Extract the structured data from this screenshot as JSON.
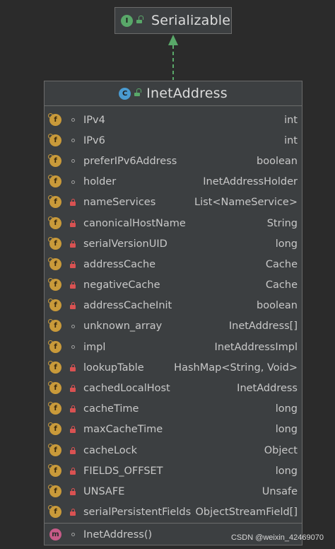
{
  "interface": {
    "badge": "I",
    "name": "Serializable"
  },
  "class": {
    "badge": "C",
    "name": "InetAddress",
    "fields": [
      {
        "name": "IPv4",
        "type": "int",
        "visibility": "package"
      },
      {
        "name": "IPv6",
        "type": "int",
        "visibility": "package"
      },
      {
        "name": "preferIPv6Address",
        "type": "boolean",
        "visibility": "package"
      },
      {
        "name": "holder",
        "type": "InetAddressHolder",
        "visibility": "package"
      },
      {
        "name": "nameServices",
        "type": "List<NameService>",
        "visibility": "private"
      },
      {
        "name": "canonicalHostName",
        "type": "String",
        "visibility": "private"
      },
      {
        "name": "serialVersionUID",
        "type": "long",
        "visibility": "private"
      },
      {
        "name": "addressCache",
        "type": "Cache",
        "visibility": "private"
      },
      {
        "name": "negativeCache",
        "type": "Cache",
        "visibility": "private"
      },
      {
        "name": "addressCacheInit",
        "type": "boolean",
        "visibility": "private"
      },
      {
        "name": "unknown_array",
        "type": "InetAddress[]",
        "visibility": "package"
      },
      {
        "name": "impl",
        "type": "InetAddressImpl",
        "visibility": "package"
      },
      {
        "name": "lookupTable",
        "type": "HashMap<String, Void>",
        "visibility": "private"
      },
      {
        "name": "cachedLocalHost",
        "type": "InetAddress",
        "visibility": "private"
      },
      {
        "name": "cacheTime",
        "type": "long",
        "visibility": "private"
      },
      {
        "name": "maxCacheTime",
        "type": "long",
        "visibility": "private"
      },
      {
        "name": "cacheLock",
        "type": "Object",
        "visibility": "private"
      },
      {
        "name": "FIELDS_OFFSET",
        "type": "long",
        "visibility": "private"
      },
      {
        "name": "UNSAFE",
        "type": "Unsafe",
        "visibility": "private"
      },
      {
        "name": "serialPersistentFields",
        "type": "ObjectStreamField[]",
        "visibility": "private"
      }
    ],
    "methods": [
      {
        "name": "InetAddress()",
        "badge": "m",
        "visibility": "package"
      }
    ]
  },
  "field_badge": "f",
  "colors": {
    "background": "#2b2b2b",
    "node_fill": "#3c3f41",
    "arrow": "#59a869",
    "interface_badge": "#59a869",
    "class_badge": "#4a9bd1",
    "field_badge": "#c99a3a",
    "method_badge": "#c75b88",
    "private_lock": "#d95252"
  },
  "watermark": "CSDN @weixin_42469070"
}
